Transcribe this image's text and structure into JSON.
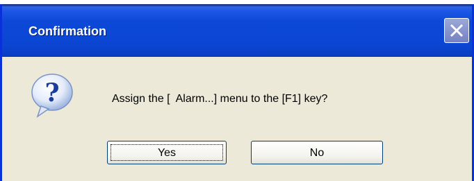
{
  "window": {
    "title": "Confirmation"
  },
  "message": {
    "text": "Assign the [  Alarm...] menu to the [F1] key?"
  },
  "buttons": {
    "yes_label": "Yes",
    "no_label": "No"
  },
  "icons": {
    "question": "question-icon",
    "close": "close-icon"
  },
  "colors": {
    "title_bar": "#0d49d8",
    "dialog_body": "#ece9d8",
    "close_button": "#7f8ccb"
  }
}
